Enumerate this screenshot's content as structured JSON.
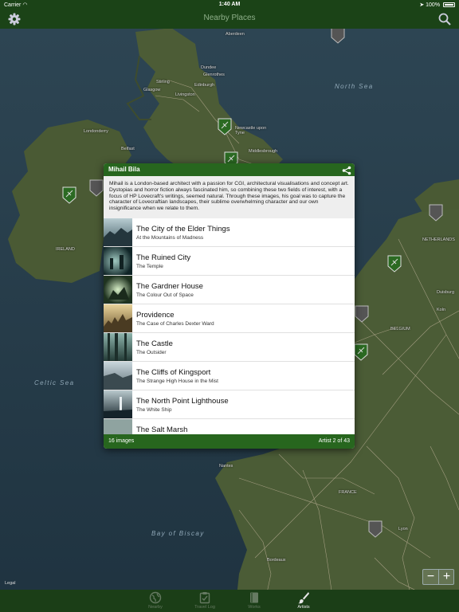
{
  "status_bar": {
    "carrier": "Carrier",
    "time": "1:40 AM",
    "battery": "100%"
  },
  "nav": {
    "title": "Nearby Places",
    "left_icon": "gear-icon",
    "right_icon": "search-icon"
  },
  "map": {
    "seas": [
      "North Sea",
      "Celtic Sea",
      "Bay of Biscay"
    ],
    "places": [
      "Aberdeen",
      "Dundee",
      "Glenrothes",
      "Stirling",
      "Edinburgh",
      "Glasgow",
      "Livingston",
      "Londonderry",
      "Belfast",
      "Newcastle upon Tyne",
      "Middlesbrough",
      "IRELAND",
      "NETHERLANDS",
      "Duisburg",
      "BELGIUM",
      "Koln",
      "Nantes",
      "FRANCE",
      "Lyon",
      "Bordeaux"
    ],
    "legal": "Legal"
  },
  "card": {
    "artist_name": "Mihail Bila",
    "bio": "Mihail is a London-based architect with a passion for CGI, architectural visualisations and concept art. Dystopias and horror fiction always fascinated him, so combining these two fields of interest, with a focus of HP Lovecraft's writings, seemed natural. Through these images, his goal was to capture the character of Lovecraftian landscapes, their sublime overwhelming character and our own insignificance when we relate to them.",
    "items": [
      {
        "title": "The City of the Elder Things",
        "subtitle": "At the Mountains of Madness"
      },
      {
        "title": "The Ruined City",
        "subtitle": "The Temple"
      },
      {
        "title": "The Gardner House",
        "subtitle": "The Colour Out of Space"
      },
      {
        "title": "Providence",
        "subtitle": "The Case of Charles Dexter Ward"
      },
      {
        "title": "The Castle",
        "subtitle": "The Outsider"
      },
      {
        "title": "The Cliffs of Kingsport",
        "subtitle": "The Strange High House in the Mist"
      },
      {
        "title": "The North Point Lighthouse",
        "subtitle": "The White Ship"
      },
      {
        "title": "The Salt Marsh",
        "subtitle": ""
      }
    ],
    "image_count": "16 images",
    "artist_position": "Artist 2 of 43"
  },
  "zoom": {
    "minus": "−",
    "plus": "+"
  },
  "tabs": [
    {
      "label": "Nearby",
      "icon": "globe-icon"
    },
    {
      "label": "Travel Log",
      "icon": "clipboard-check-icon"
    },
    {
      "label": "Works",
      "icon": "book-icon"
    },
    {
      "label": "Artists",
      "icon": "paintbrush-icon",
      "active": true
    }
  ],
  "colors": {
    "bar": "#1b4317",
    "card_accent": "#27661e",
    "tab_inactive": "#667a62"
  }
}
